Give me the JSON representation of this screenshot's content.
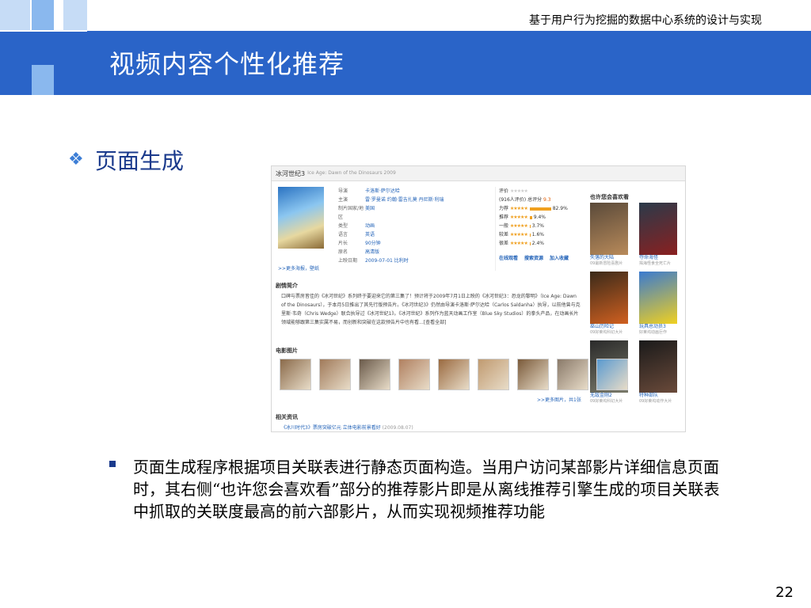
{
  "header": {
    "caption": "基于用户行为挖掘的数据中心系统的设计与实现",
    "title": "视频内容个性化推荐"
  },
  "section": {
    "subtitle": "页面生成"
  },
  "screenshot": {
    "movie_title": "冰河世纪3",
    "movie_title_en": "Ice Age: Dawn of the Dinosaurs 2009",
    "meta": [
      {
        "k": "导演",
        "v": "卡洛斯·萨尔达哈"
      },
      {
        "k": "主演",
        "v": "雷·罗曼诺 约翰·雷吉扎莫 丹尼斯·利瑞"
      },
      {
        "k": "制片国家/地区",
        "v": "美国"
      },
      {
        "k": "类型",
        "v": "动画"
      },
      {
        "k": "语言",
        "v": "英语"
      },
      {
        "k": "片长",
        "v": "90分钟"
      },
      {
        "k": "原名",
        "v": "高清版"
      },
      {
        "k": "上映日期",
        "v": "2009-07-01 比利时"
      }
    ],
    "poster_link": ">>更多海报，壁纸",
    "rating": {
      "label": "评价",
      "count": "(916人评价)",
      "score_label": "总评分",
      "score": "9.3",
      "rows": [
        {
          "label": "力荐",
          "pct": "82.9%",
          "frac": 0.829
        },
        {
          "label": "推荐",
          "pct": "9.4%",
          "frac": 0.094
        },
        {
          "label": "一般",
          "pct": "3.7%",
          "frac": 0.037
        },
        {
          "label": "较差",
          "pct": "1.6%",
          "frac": 0.016
        },
        {
          "label": "很差",
          "pct": "2.4%",
          "frac": 0.024
        }
      ],
      "actions": [
        "在线观看",
        "搜索资源",
        "加入收藏"
      ]
    },
    "rec_head": "也许您会喜欢看",
    "recs": [
      {
        "title": "失落的大陆",
        "sub": "09最新冒险喜剧片",
        "c1": "#5a4a3a",
        "c2": "#b88a5a"
      },
      {
        "title": "夺命海怪",
        "sub": "揭海怪食全死亡片",
        "c1": "#2a3a4a",
        "c2": "#8a2020"
      },
      {
        "title": "巫山历险记",
        "sub": "09好莱坞科幻大片",
        "c1": "#3a2a1a",
        "c2": "#d06020"
      },
      {
        "title": "玩具总动员3",
        "sub": "好莱坞动画巨作",
        "c1": "#3a7ad0",
        "c2": "#f0d020"
      },
      {
        "title": "无敌金刚2",
        "sub": "09好莱坞科幻大片",
        "c1": "#2a2a2a",
        "c2": "#7a7a6a"
      },
      {
        "title": "特种部队",
        "sub": "09好莱坞动作大片",
        "c1": "#1a1a1a",
        "c2": "#6a4a3a"
      }
    ],
    "synopsis_head": "剧情简介",
    "synopsis": "口碑与票房皆佳的《冰河世纪》系列终于要迎来它的第三集了！预计将于2009年7月1日上映的《冰河世纪3：恐龙的黎明》（Ice Age: Dawn of the Dinosaurs），于本月5日推出了其先行版预告片。《冰河世纪3》仍然由导演卡洛斯·萨尔达哈（Carlos Saldanha）执导，以前他曾与克里斯·韦奇（Chris Wedge）联合执导过《冰河世纪1》。《冰河世纪》系列作为蓝天动画工作室（Blue Sky Studios）的拳头产品，在动画长片领域能够跟第三集实属不易，而创新和突破在这款预告片中也有看...[查看全部]",
    "stills_head": "电影图片",
    "stills": [
      "#8a6a4a",
      "#a07a5a",
      "#6a5a4a",
      "#b08060",
      "#9a6a40",
      "#c09a70",
      "#7a5a3a",
      "#8a7a6a",
      "#5a9ad0"
    ],
    "stills_more": ">>更多图片，共1张",
    "news_head": "相关资讯",
    "news": "《冰川时代3》票房突破亿元 立体电影前景看好",
    "news_date": "(2009.08.07)"
  },
  "body": {
    "paragraph": "页面生成程序根据项目关联表进行静态页面构造。当用户访问某部影片详细信息页面时，其右侧“也许您会喜欢看”部分的推荐影片即是从离线推荐引擎生成的项目关联表中抓取的关联度最高的前六部影片，从而实现视频推荐功能"
  },
  "footer": {
    "page_number": "22"
  },
  "colors": {
    "header_band": "#2a64c8",
    "accent_light": "#8ab8ee",
    "accent_pale": "#c6dcf6",
    "subtitle": "#1a3a8c",
    "link": "#2363b8"
  }
}
